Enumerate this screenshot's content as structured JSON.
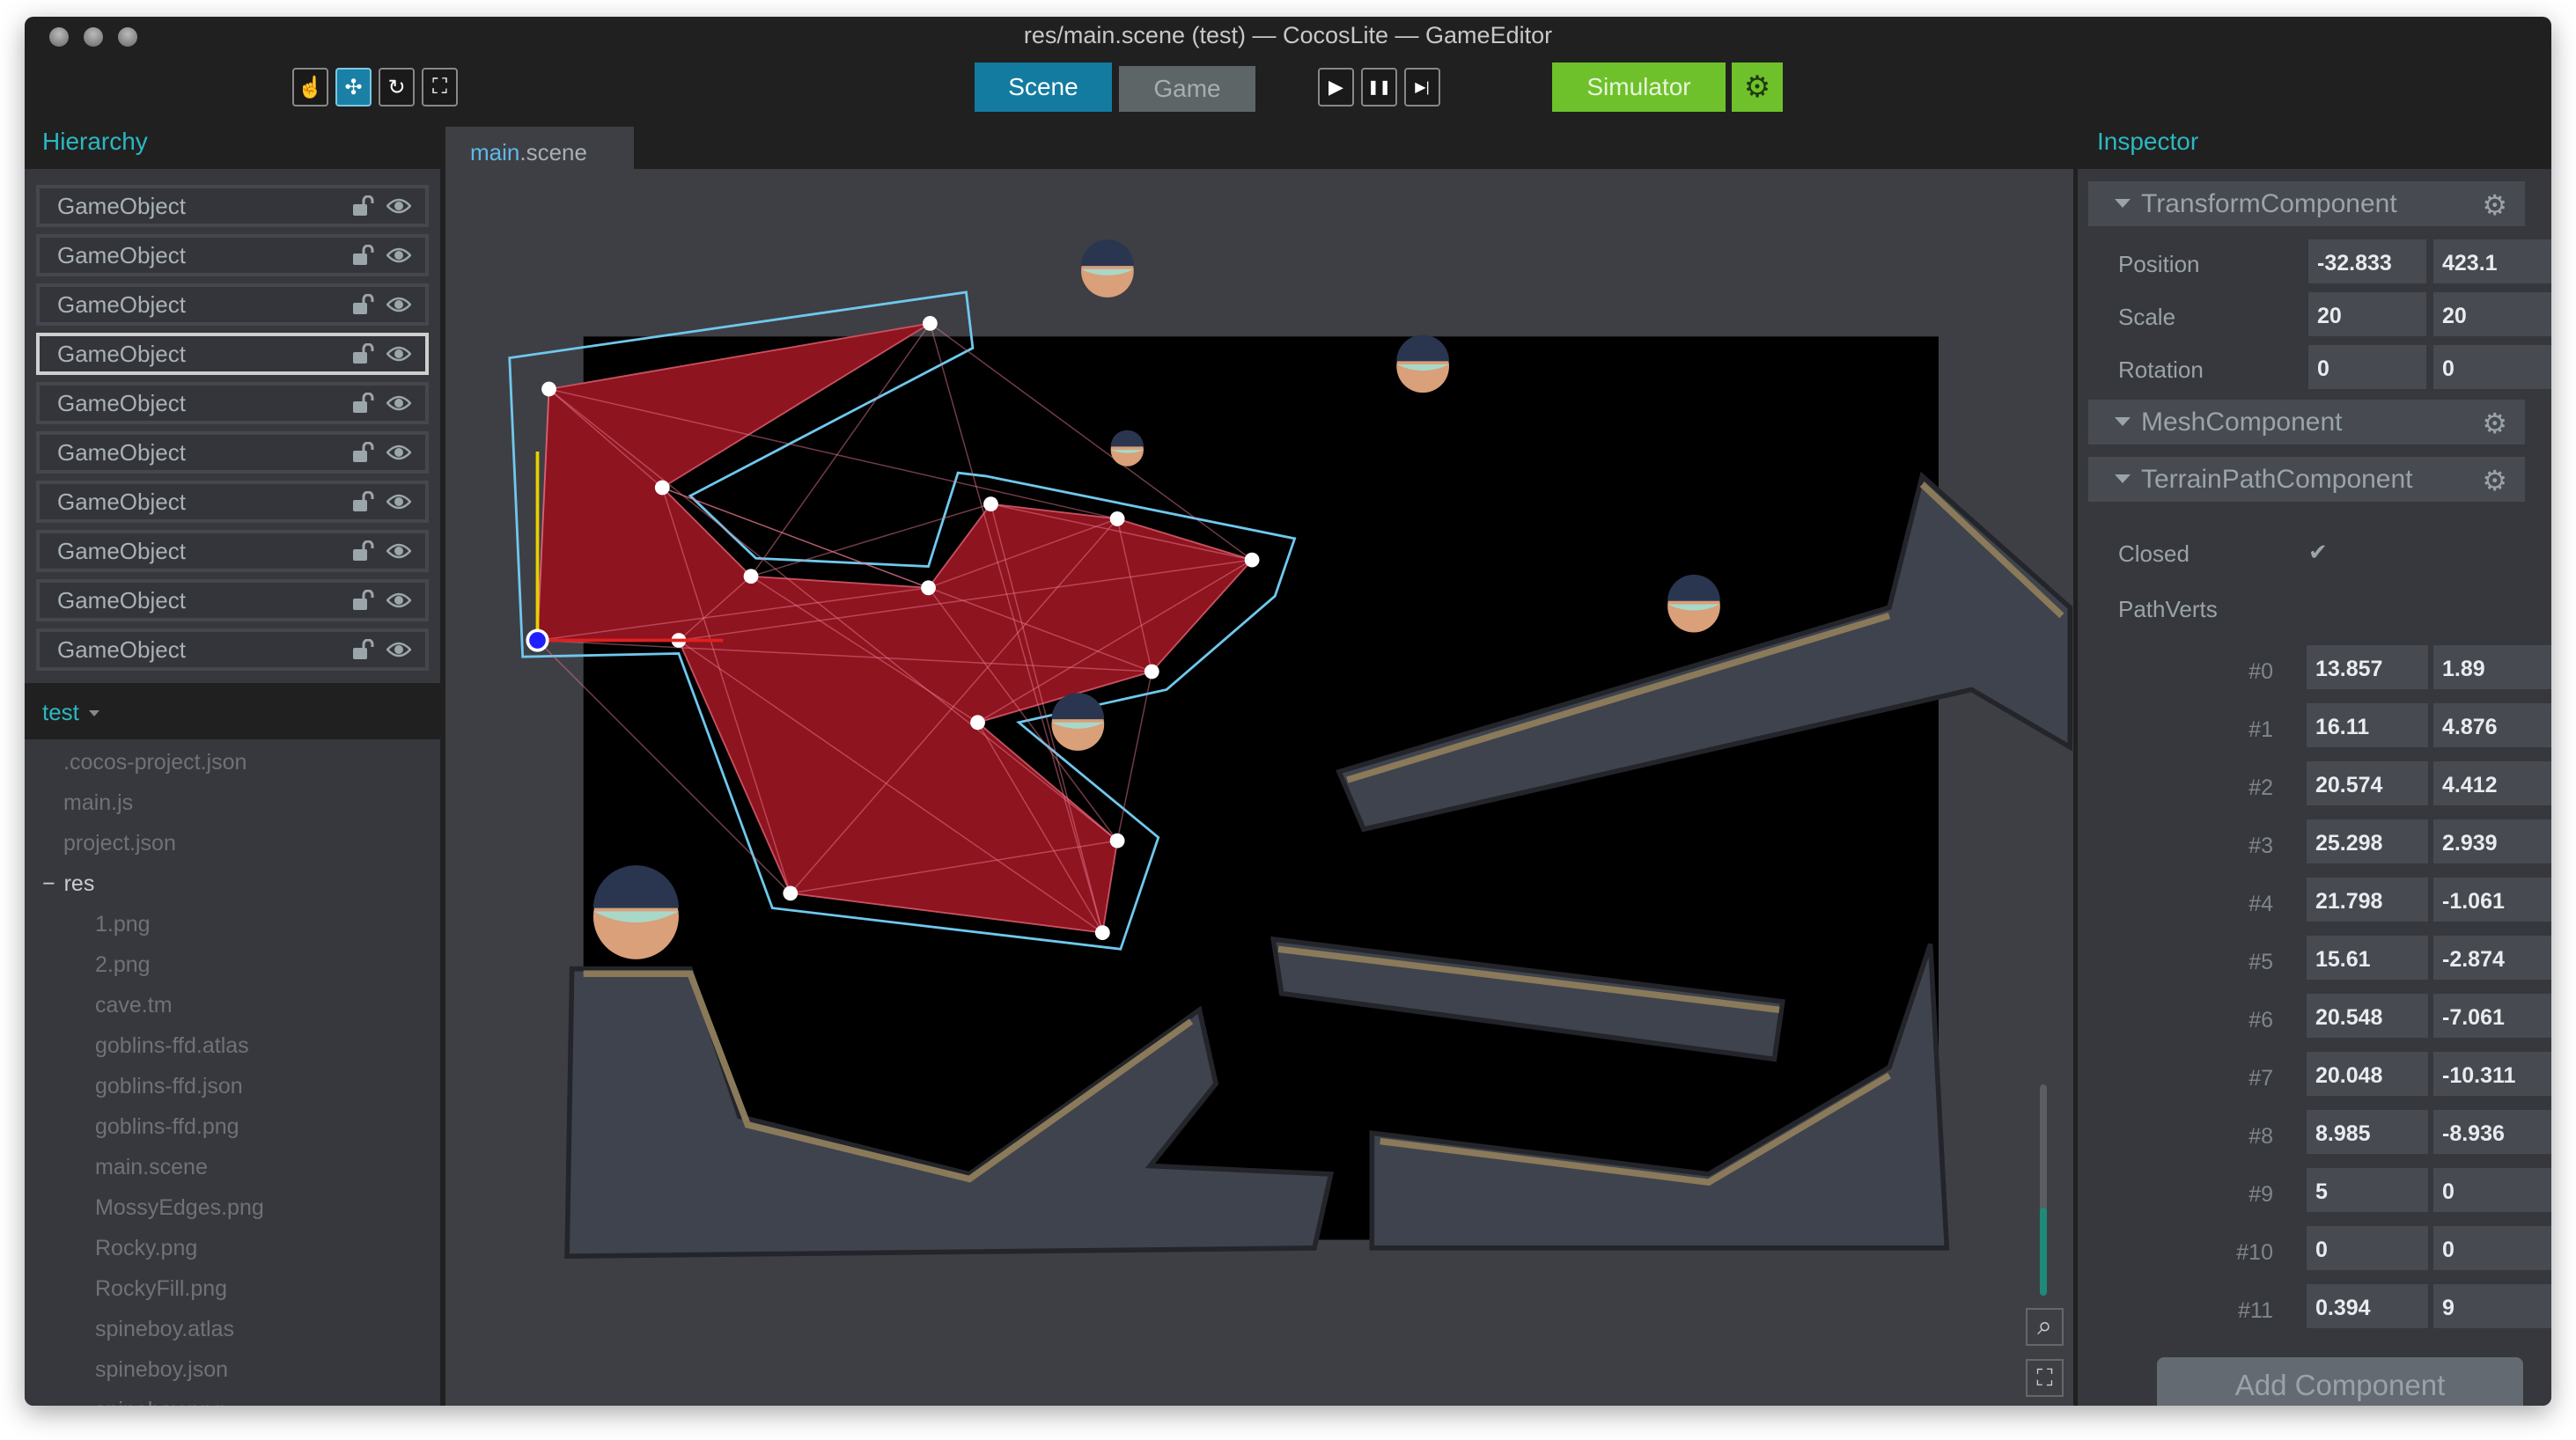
{
  "window": {
    "title": "res/main.scene (test) — CocosLite — GameEditor"
  },
  "toolbar": {
    "tools": [
      {
        "name": "hand-tool",
        "icon": "hand-icon",
        "glyph": "☝",
        "active": false
      },
      {
        "name": "move-tool",
        "icon": "move-icon",
        "glyph": "✣",
        "active": true
      },
      {
        "name": "rotate-tool",
        "icon": "rotate-icon",
        "glyph": "↻",
        "active": false
      },
      {
        "name": "scale-tool",
        "icon": "fullscreen-icon",
        "glyph": "⛶",
        "active": false
      }
    ],
    "scene_label": "Scene",
    "game_label": "Game",
    "play_glyph": "▶",
    "pause_glyph": "❚❚",
    "step_glyph": "▶|",
    "simulator_label": "Simulator",
    "gear_glyph": "⚙",
    "colors": {
      "accent": "#1a80a6",
      "simulator": "#6ec12a",
      "panel_title": "#2bb8c2"
    }
  },
  "hierarchy": {
    "title": "Hierarchy",
    "items": [
      {
        "label": "GameObject",
        "selected": false
      },
      {
        "label": "GameObject",
        "selected": false
      },
      {
        "label": "GameObject",
        "selected": false
      },
      {
        "label": "GameObject",
        "selected": true
      },
      {
        "label": "GameObject",
        "selected": false
      },
      {
        "label": "GameObject",
        "selected": false
      },
      {
        "label": "GameObject",
        "selected": false
      },
      {
        "label": "GameObject",
        "selected": false
      },
      {
        "label": "GameObject",
        "selected": false
      },
      {
        "label": "GameObject",
        "selected": false
      }
    ]
  },
  "project": {
    "name": "test",
    "files": [
      ".cocos-project.json",
      "main.js",
      "project.json"
    ],
    "folder": {
      "toggle": "−",
      "name": "res",
      "files": [
        "1.png",
        "2.png",
        "cave.tm",
        "goblins-ffd.atlas",
        "goblins-ffd.json",
        "goblins-ffd.png",
        "main.scene",
        "MossyEdges.png",
        "Rocky.png",
        "RockyFill.png",
        "spineboy.atlas",
        "spineboy.json",
        "spineboy.png"
      ]
    }
  },
  "editor": {
    "tab_name": "main",
    "tab_ext": ".scene",
    "search_glyph": "⌕",
    "fit_glyph": "⛶"
  },
  "inspector": {
    "title": "Inspector",
    "transform": {
      "title": "TransformComponent",
      "position_label": "Position",
      "position": [
        "-32.833",
        "423.1"
      ],
      "scale_label": "Scale",
      "scale": [
        "20",
        "20"
      ],
      "rotation_label": "Rotation",
      "rotation": [
        "0",
        "0"
      ]
    },
    "mesh": {
      "title": "MeshComponent"
    },
    "terrain": {
      "title": "TerrainPathComponent",
      "closed_label": "Closed",
      "closed": true,
      "check_glyph": "✔",
      "pathverts_label": "PathVerts",
      "verts": [
        {
          "i": "#0",
          "x": "13.857",
          "y": "1.89"
        },
        {
          "i": "#1",
          "x": "16.11",
          "y": "4.876"
        },
        {
          "i": "#2",
          "x": "20.574",
          "y": "4.412"
        },
        {
          "i": "#3",
          "x": "25.298",
          "y": "2.939"
        },
        {
          "i": "#4",
          "x": "21.798",
          "y": "-1.061"
        },
        {
          "i": "#5",
          "x": "15.61",
          "y": "-2.874"
        },
        {
          "i": "#6",
          "x": "20.548",
          "y": "-7.061"
        },
        {
          "i": "#7",
          "x": "20.048",
          "y": "-10.311"
        },
        {
          "i": "#8",
          "x": "8.985",
          "y": "-8.936"
        },
        {
          "i": "#9",
          "x": "5",
          "y": "0"
        },
        {
          "i": "#10",
          "x": "0",
          "y": "0"
        },
        {
          "i": "#11",
          "x": "0.394",
          "y": "9"
        }
      ]
    },
    "add_component_label": "Add Component"
  }
}
